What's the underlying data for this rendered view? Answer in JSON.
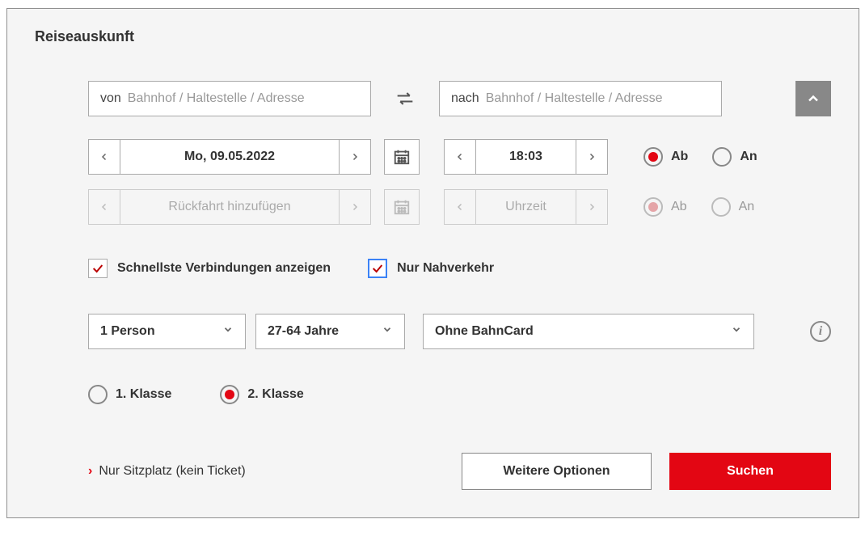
{
  "title": "Reiseauskunft",
  "from": {
    "prefix": "von",
    "placeholder": "Bahnhof / Haltestelle / Adresse",
    "value": ""
  },
  "to": {
    "prefix": "nach",
    "placeholder": "Bahnhof / Haltestelle / Adresse",
    "value": ""
  },
  "outbound": {
    "date": "Mo, 09.05.2022",
    "time": "18:03"
  },
  "return": {
    "date_placeholder": "Rückfahrt hinzufügen",
    "time_placeholder": "Uhrzeit"
  },
  "ab_an": {
    "ab": "Ab",
    "an": "An"
  },
  "checks": {
    "fastest": "Schnellste Verbindungen anzeigen",
    "local": "Nur Nahverkehr"
  },
  "selects": {
    "persons": "1 Person",
    "age": "27-64 Jahre",
    "card": "Ohne BahnCard"
  },
  "class": {
    "first": "1. Klasse",
    "second": "2. Klasse"
  },
  "seat_only": "Nur Sitzplatz (kein Ticket)",
  "buttons": {
    "more": "Weitere Optionen",
    "search": "Suchen"
  },
  "colors": {
    "brand": "#e30613"
  }
}
